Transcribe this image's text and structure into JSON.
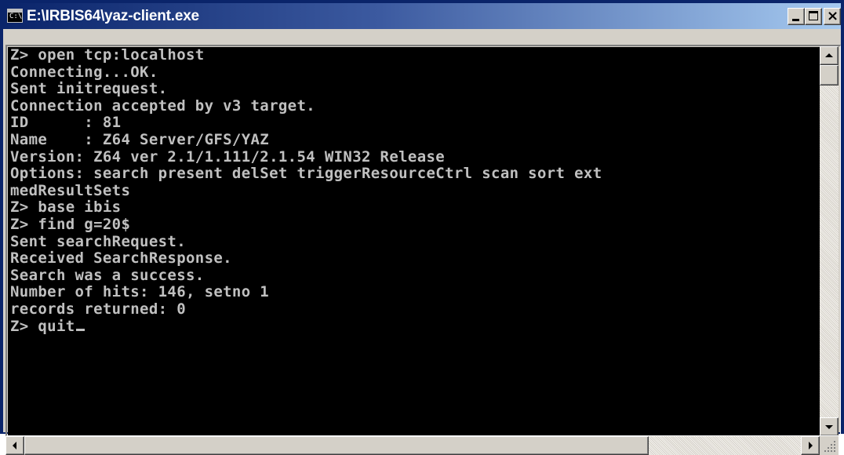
{
  "window": {
    "title": "E:\\IRBIS64\\yaz-client.exe",
    "icon_glyph": "C:\\",
    "controls": {
      "minimize": "minimize-icon",
      "maximize": "maximize-icon",
      "close": "×"
    }
  },
  "console": {
    "lines": [
      "Z> open tcp:localhost",
      "Connecting...OK.",
      "Sent initrequest.",
      "Connection accepted by v3 target.",
      "ID      : 81",
      "Name    : Z64 Server/GFS/YAZ",
      "Version: Z64 ver 2.1/1.111/2.1.54 WIN32 Release",
      "Options: search present delSet triggerResourceCtrl scan sort ext",
      "medResultSets",
      "Z> base ibis",
      "Z> find g=20$",
      "Sent searchRequest.",
      "Received SearchResponse.",
      "Search was a success.",
      "Number of hits: 146, setno 1",
      "records returned: 0",
      "Z> quit"
    ]
  },
  "colors": {
    "title_bar_start": "#0a246a",
    "title_bar_end": "#a6caf0",
    "console_background": "#000000",
    "console_text": "#c0c0c0",
    "chrome": "#d4d0c8"
  }
}
